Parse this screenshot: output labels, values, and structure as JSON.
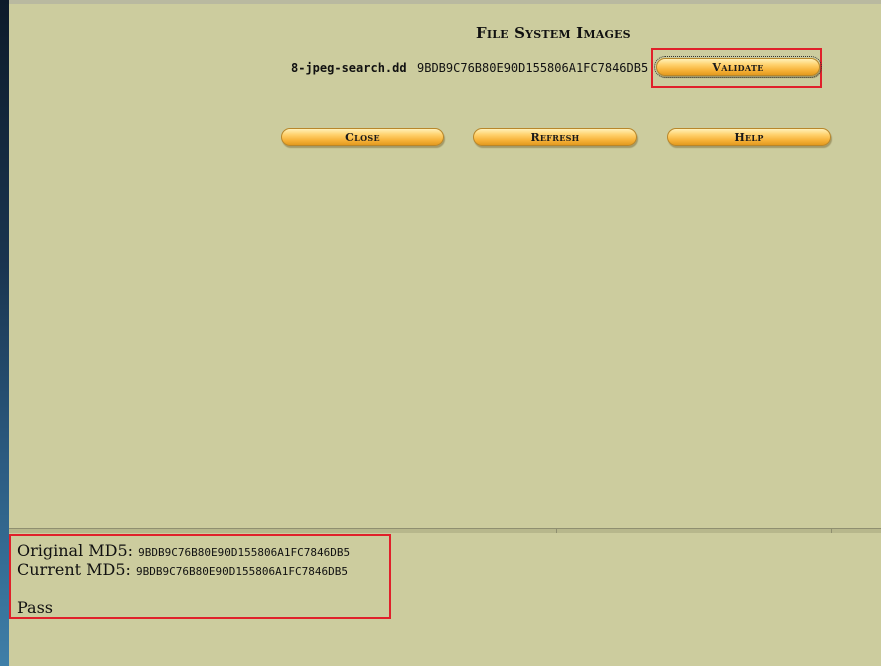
{
  "title": "File System Images",
  "image": {
    "name": "8-jpeg-search.dd",
    "md5": "9BDB9C76B80E90D155806A1FC7846DB5"
  },
  "buttons": {
    "validate": "Validate",
    "close": "Close",
    "refresh": "Refresh",
    "help": "Help"
  },
  "result": {
    "original_label": "Original MD5:",
    "original_md5": "9BDB9C76B80E90D155806A1FC7846DB5",
    "current_label": "Current MD5:",
    "current_md5": "9BDB9C76B80E90D155806A1FC7846DB5",
    "status": "Pass"
  },
  "colors": {
    "frame_background": "#cccc9e",
    "button_gradient_mid": "#f7b33a",
    "highlight_border": "#e0202a"
  }
}
